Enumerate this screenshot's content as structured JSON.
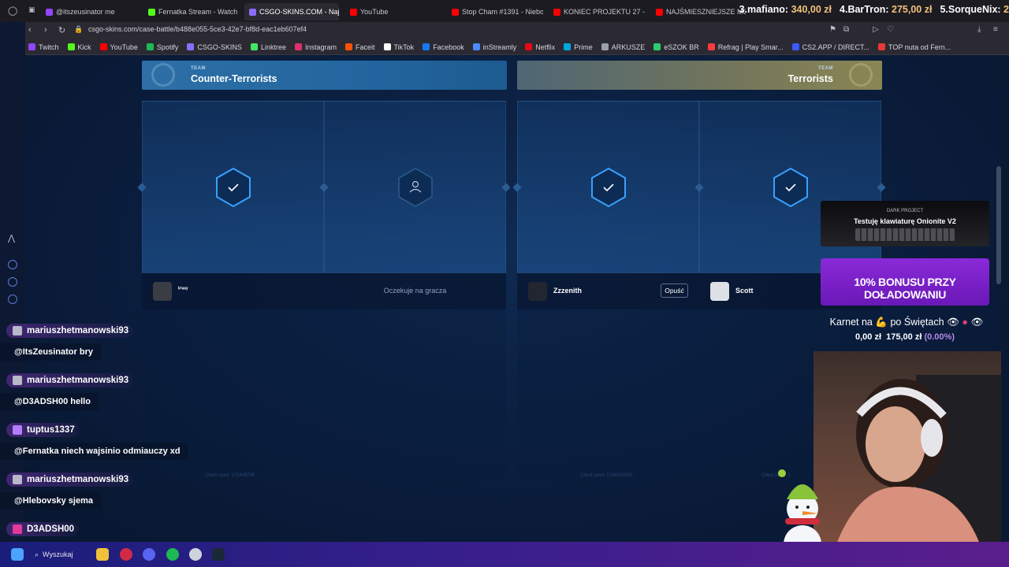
{
  "browser": {
    "tabs": [
      {
        "label": "@itszeusinator me",
        "color": "#9146ff"
      },
      {
        "label": "Fernatka Stream - Watch",
        "color": "#53fc18"
      },
      {
        "label": "CSGO-SKINS.COM - Naj",
        "color": "#8a6cff",
        "active": true
      },
      {
        "label": "YouTube",
        "color": "#ff0000"
      },
      {
        "label": "Stop Cham #1391 - Niebo",
        "color": "#ff0000"
      },
      {
        "label": "KONIEC PROJEKTU 27 -",
        "color": "#ff0000"
      },
      {
        "label": "NAJŚMIESZNIEJSZE MO",
        "color": "#ff0000"
      }
    ],
    "url": "csgo-skins.com/case-battle/b488e055-5ce3-42e7-bf8d-eac1eb607ef4",
    "bookmarks": [
      {
        "label": "Twitch",
        "color": "#9146ff"
      },
      {
        "label": "Kick",
        "color": "#53fc18"
      },
      {
        "label": "YouTube",
        "color": "#ff0000"
      },
      {
        "label": "Spotify",
        "color": "#1db954"
      },
      {
        "label": "CSGO-SKINS",
        "color": "#8a6cff"
      },
      {
        "label": "Linktree",
        "color": "#43e660"
      },
      {
        "label": "Instagram",
        "color": "#e1306c"
      },
      {
        "label": "Faceit",
        "color": "#ff5500"
      },
      {
        "label": "TikTok",
        "color": "#ffffff"
      },
      {
        "label": "Facebook",
        "color": "#1877f2"
      },
      {
        "label": "inStreamly",
        "color": "#4b8bff"
      },
      {
        "label": "Netflix",
        "color": "#e50914"
      },
      {
        "label": "Prime",
        "color": "#00a8e1"
      },
      {
        "label": "ARKUSZE",
        "color": "#9aa0a6"
      },
      {
        "label": "eSZOK BR",
        "color": "#2ecc71"
      },
      {
        "label": "Refrag | Play Smar...",
        "color": "#ff3b3b"
      },
      {
        "label": "CS2.APP / DIRECT...",
        "color": "#3d5afe"
      },
      {
        "label": "TOP nuta od Fern...",
        "color": "#e53935"
      }
    ]
  },
  "leaderboard": [
    {
      "label": "3.mafiano:",
      "amount": "340,00 zł"
    },
    {
      "label": "4.BarTron:",
      "amount": "275,00 zł"
    },
    {
      "label": "5.SorqueNix:",
      "amount": "2"
    }
  ],
  "battle": {
    "teams": [
      {
        "tag": "TEAM",
        "name": "Counter-Terrorists"
      },
      {
        "tag": "TEAM",
        "name": "Terrorists"
      }
    ],
    "slots": [
      {
        "status": "ready",
        "player": "ᵏ²ᵃᵉʸ",
        "action": ""
      },
      {
        "status": "waiting",
        "player": "Oczekuje na gracza",
        "action": ""
      },
      {
        "status": "ready",
        "player": "Zzzenith",
        "action": "Opuść"
      },
      {
        "status": "ready",
        "player": "Scott",
        "action": ""
      }
    ],
    "seeds": [
      "Client seed: 173448785",
      "Client seed: 1748190591",
      "Client seed: 1"
    ]
  },
  "chat": [
    {
      "user": "mariuszhetmanowski93",
      "message": "@ItsZeusinator bry"
    },
    {
      "user": "mariuszhetmanowski93",
      "message": "@D3ADSH00 hello"
    },
    {
      "user": "tuptus1337",
      "message": "@Fernatka niech wajsinio odmiauczy xd"
    },
    {
      "user": "mariuszhetmanowski93",
      "message": "@Hlebovsky sjema"
    },
    {
      "user": "D3ADSH00",
      "message": ""
    }
  ],
  "overlay": {
    "keyboard_brand": "DARK PROJECT",
    "keyboard_text": "Testuję klawiaturę Onionite V2",
    "bonus_text": "10% BONUSU PRZY DOŁADOWANIU",
    "goal_title_a": "Karnet na",
    "goal_title_b": "po Świętach",
    "goal_current": "0,00 zł",
    "goal_target": "175,00 zł",
    "goal_percent": "(0.00%)"
  },
  "taskbar": {
    "search_label": "Wyszukaj"
  }
}
